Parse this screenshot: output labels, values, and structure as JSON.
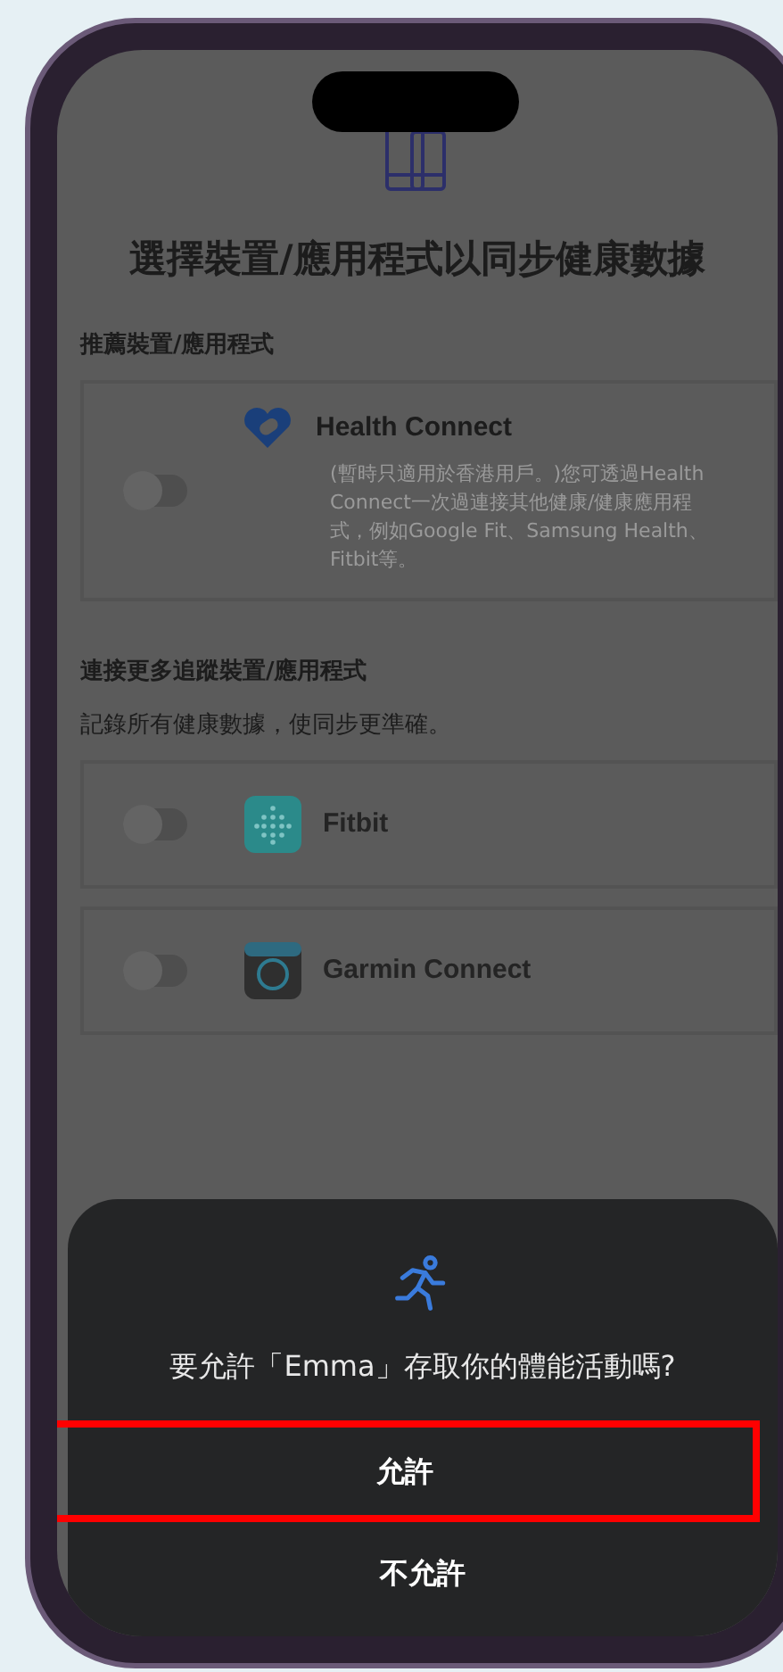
{
  "title": "選擇裝置/應用程式以同步健康數據",
  "recommended": {
    "heading": "推薦裝置/應用程式",
    "items": [
      {
        "kind": "health",
        "name": "Health Connect",
        "on": false,
        "description": "(暫時只適用於香港用戶。)您可透過Health Connect一次過連接其他健康/健康應用程式，例如Google Fit、Samsung Health、Fitbit等。"
      }
    ]
  },
  "more": {
    "heading": "連接更多追蹤裝置/應用程式",
    "subtitle": "記錄所有健康數據，使同步更準確。",
    "items": [
      {
        "kind": "fitbit",
        "name": "Fitbit",
        "on": false
      },
      {
        "kind": "garmin",
        "name": "Garmin Connect",
        "on": false
      }
    ]
  },
  "dialog": {
    "message": "要允許「Emma」存取你的體能活動嗎?",
    "buttons": [
      {
        "label": "允許",
        "highlighted": true
      },
      {
        "label": "不允許",
        "highlighted": false
      }
    ]
  }
}
